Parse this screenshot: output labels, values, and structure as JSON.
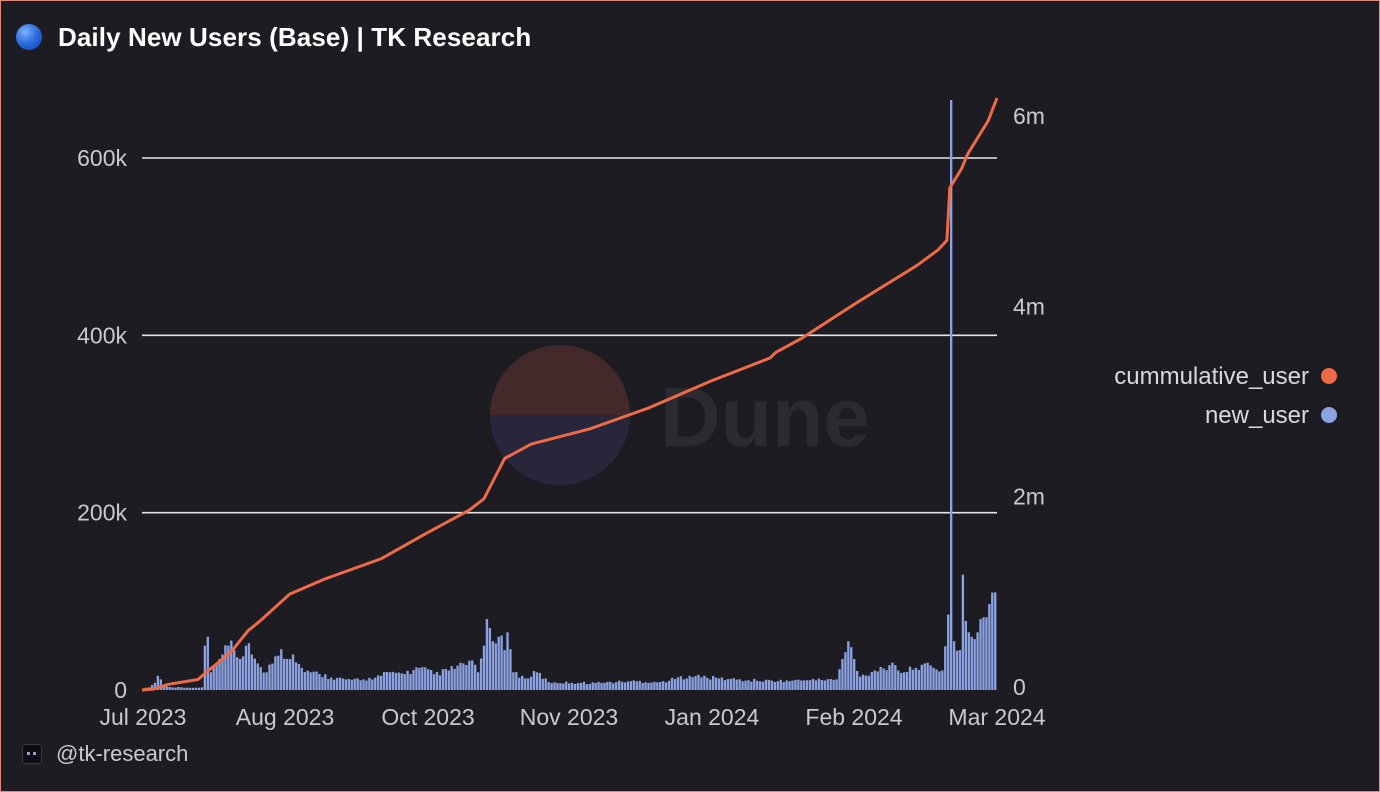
{
  "header": {
    "title": "Daily New Users (Base) | TK Research"
  },
  "watermark": {
    "text": "Dune"
  },
  "footer": {
    "handle": "@tk-research"
  },
  "colors": {
    "cumulative": "#ef6a46",
    "new_user": "#8ca3e3",
    "grid": "#e6e6e6",
    "background": "#1d1c22"
  },
  "chart_data": {
    "type": "bar",
    "x_ticks": [
      "Jul 2023",
      "Aug 2023",
      "Oct 2023",
      "Nov 2023",
      "Jan 2024",
      "Feb 2024",
      "Mar 2024"
    ],
    "x_range": [
      "2023-07-01",
      "2024-03-01"
    ],
    "left_axis": {
      "ticks": [
        "0",
        "200k",
        "400k",
        "600k"
      ],
      "ylim": [
        0,
        600000
      ]
    },
    "right_axis": {
      "ticks": [
        "0",
        "2m",
        "4m",
        "6m"
      ],
      "ylim": [
        0,
        6000000
      ]
    },
    "grid": true,
    "legend_position": "right",
    "series": [
      {
        "name": "cummulative_user",
        "type": "line",
        "axis": "right",
        "points": [
          [
            "2023-07-01",
            0
          ],
          [
            "2023-07-05",
            10000
          ],
          [
            "2023-07-10",
            60000
          ],
          [
            "2023-07-20",
            110000
          ],
          [
            "2023-07-23",
            190000
          ],
          [
            "2023-07-31",
            390000
          ],
          [
            "2023-08-06",
            620000
          ],
          [
            "2023-08-10",
            720000
          ],
          [
            "2023-08-20",
            1000000
          ],
          [
            "2023-09-01",
            1160000
          ],
          [
            "2023-09-20",
            1370000
          ],
          [
            "2023-10-05",
            1630000
          ],
          [
            "2023-10-20",
            1880000
          ],
          [
            "2023-10-25",
            2000000
          ],
          [
            "2023-11-01",
            2420000
          ],
          [
            "2023-11-10",
            2570000
          ],
          [
            "2023-11-30",
            2730000
          ],
          [
            "2023-12-20",
            2950000
          ],
          [
            "2024-01-10",
            3230000
          ],
          [
            "2024-01-30",
            3470000
          ],
          [
            "2024-02-01",
            3530000
          ],
          [
            "2024-02-10",
            3680000
          ],
          [
            "2024-02-20",
            3880000
          ],
          [
            "2024-02-28",
            4040000
          ],
          [
            "2024-03-10",
            4250000
          ],
          [
            "2024-03-20",
            4440000
          ],
          [
            "2024-03-27",
            4600000
          ],
          [
            "2024-03-30",
            4700000
          ],
          [
            "2024-03-31",
            5250000
          ],
          [
            "2024-04-01",
            5300000
          ],
          [
            "2024-04-04",
            5450000
          ],
          [
            "2024-04-06",
            5600000
          ],
          [
            "2024-04-13",
            5950000
          ],
          [
            "2024-04-16",
            6200000
          ]
        ]
      },
      {
        "name": "new_user",
        "type": "bar",
        "axis": "left",
        "points": [
          [
            "2023-07-01",
            1500
          ],
          [
            "2023-07-03",
            3000
          ],
          [
            "2023-07-05",
            8000
          ],
          [
            "2023-07-06",
            16000
          ],
          [
            "2023-07-07",
            12000
          ],
          [
            "2023-07-08",
            5000
          ],
          [
            "2023-07-09",
            4000
          ],
          [
            "2023-07-11",
            3000
          ],
          [
            "2023-07-14",
            3000
          ],
          [
            "2023-07-17",
            2500
          ],
          [
            "2023-07-20",
            2500
          ],
          [
            "2023-07-21",
            3000
          ],
          [
            "2023-07-22",
            50000
          ],
          [
            "2023-07-23",
            60000
          ],
          [
            "2023-07-24",
            20000
          ],
          [
            "2023-07-26",
            30000
          ],
          [
            "2023-07-28",
            40000
          ],
          [
            "2023-07-30",
            50000
          ],
          [
            "2023-08-01",
            45000
          ],
          [
            "2023-08-03",
            35000
          ],
          [
            "2023-08-05",
            50000
          ],
          [
            "2023-08-07",
            40000
          ],
          [
            "2023-08-09",
            30000
          ],
          [
            "2023-08-12",
            20000
          ],
          [
            "2023-08-15",
            38000
          ],
          [
            "2023-08-17",
            46000
          ],
          [
            "2023-08-19",
            35000
          ],
          [
            "2023-08-21",
            40000
          ],
          [
            "2023-08-24",
            25000
          ],
          [
            "2023-08-27",
            20000
          ],
          [
            "2023-08-30",
            18000
          ],
          [
            "2023-09-03",
            14000
          ],
          [
            "2023-09-08",
            12000
          ],
          [
            "2023-09-13",
            11000
          ],
          [
            "2023-09-18",
            14000
          ],
          [
            "2023-09-23",
            20000
          ],
          [
            "2023-09-28",
            18000
          ],
          [
            "2023-10-03",
            25000
          ],
          [
            "2023-10-08",
            18000
          ],
          [
            "2023-10-13",
            22000
          ],
          [
            "2023-10-18",
            30000
          ],
          [
            "2023-10-20",
            33000
          ],
          [
            "2023-10-23",
            20000
          ],
          [
            "2023-10-25",
            50000
          ],
          [
            "2023-10-26",
            80000
          ],
          [
            "2023-10-28",
            55000
          ],
          [
            "2023-10-30",
            60000
          ],
          [
            "2023-11-01",
            45000
          ],
          [
            "2023-11-02",
            65000
          ],
          [
            "2023-11-04",
            20000
          ],
          [
            "2023-11-08",
            13000
          ],
          [
            "2023-11-12",
            20000
          ],
          [
            "2023-11-16",
            9000
          ],
          [
            "2023-11-24",
            8000
          ],
          [
            "2023-12-04",
            8000
          ],
          [
            "2023-12-14",
            10000
          ],
          [
            "2023-12-24",
            9000
          ],
          [
            "2024-01-03",
            16000
          ],
          [
            "2024-01-13",
            13000
          ],
          [
            "2024-01-23",
            11000
          ],
          [
            "2024-02-02",
            10000
          ],
          [
            "2024-02-12",
            11000
          ],
          [
            "2024-02-22",
            12000
          ],
          [
            "2024-02-26",
            55000
          ],
          [
            "2024-03-01",
            15000
          ],
          [
            "2024-03-06",
            22000
          ],
          [
            "2024-03-11",
            28000
          ],
          [
            "2024-03-16",
            20000
          ],
          [
            "2024-03-20",
            25000
          ],
          [
            "2024-03-23",
            30000
          ],
          [
            "2024-03-26",
            25000
          ],
          [
            "2024-03-29",
            22000
          ],
          [
            "2024-03-31",
            85000
          ],
          [
            "2024-04-01",
            670000
          ],
          [
            "2024-04-02",
            55000
          ],
          [
            "2024-04-04",
            45000
          ],
          [
            "2024-04-05",
            130000
          ],
          [
            "2024-04-06",
            78000
          ],
          [
            "2024-04-07",
            65000
          ],
          [
            "2024-04-08",
            60000
          ],
          [
            "2024-04-10",
            65000
          ],
          [
            "2024-04-11",
            80000
          ],
          [
            "2024-04-13",
            82000
          ],
          [
            "2024-04-14",
            97000
          ],
          [
            "2024-04-15",
            110000
          ],
          [
            "2024-04-16",
            110000
          ]
        ]
      }
    ]
  }
}
